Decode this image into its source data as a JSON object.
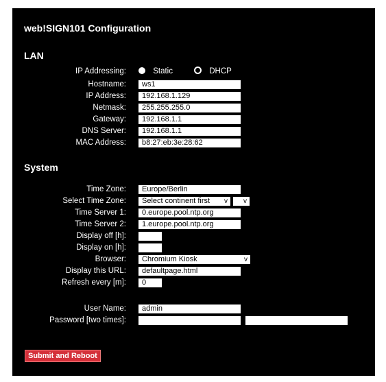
{
  "title": "web!SIGN101 Configuration",
  "lan": {
    "heading": "LAN",
    "ip_addressing_label": "IP Addressing:",
    "static_label": "Static",
    "dhcp_label": "DHCP",
    "selected_mode": "Static",
    "hostname_label": "Hostname:",
    "hostname": "ws1",
    "ip_label": "IP Address:",
    "ip": "192.168.1.129",
    "netmask_label": "Netmask:",
    "netmask": "255.255.255.0",
    "gateway_label": "Gateway:",
    "gateway": "192.168.1.1",
    "dns_label": "DNS Server:",
    "dns": "192.168.1.1",
    "mac_label": "MAC Address:",
    "mac": "b8:27:eb:3e:28:62"
  },
  "system": {
    "heading": "System",
    "timezone_label": "Time Zone:",
    "timezone": "Europe/Berlin",
    "select_tz_label": "Select Time Zone:",
    "continent_select": "Select continent first",
    "region_select": "",
    "ts1_label": "Time Server 1:",
    "ts1": "0.europe.pool.ntp.org",
    "ts2_label": "Time Server 2:",
    "ts2": "1.europe.pool.ntp.org",
    "display_off_label": "Display off [h]:",
    "display_off": "",
    "display_on_label": "Display on [h]:",
    "display_on": "",
    "browser_label": "Browser:",
    "browser": "Chromium Kiosk",
    "url_label": "Display this URL:",
    "url": "defaultpage.html",
    "refresh_label": "Refresh every [m]:",
    "refresh": "0",
    "user_label": "User Name:",
    "user": "admin",
    "password_label": "Password [two times]:",
    "password1": "",
    "password2": ""
  },
  "submit_label": "Submit and Reboot",
  "colors": {
    "background": "#000000",
    "button": "#d4303a"
  }
}
